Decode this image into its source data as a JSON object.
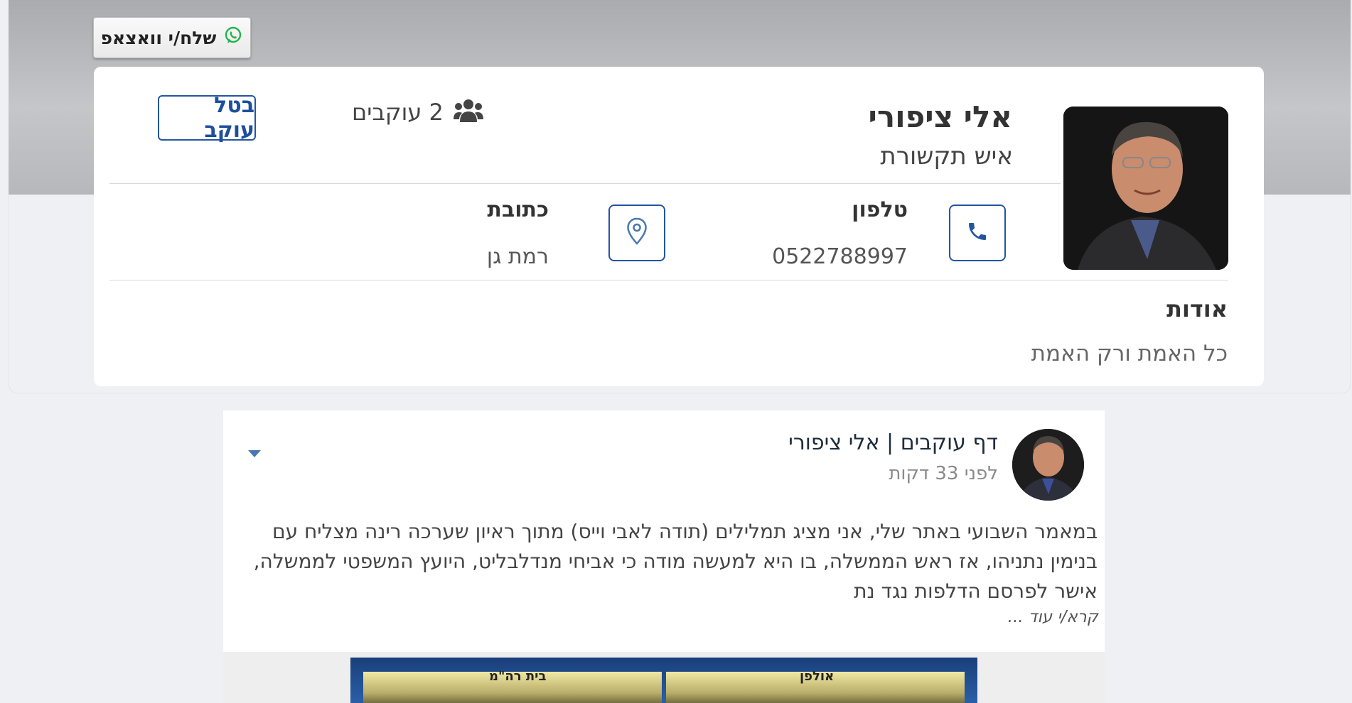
{
  "header": {
    "whatsapp_label": "שלח/י וואצאפ",
    "colors": {
      "whatsapp_icon": "#25b34a",
      "accent": "#2355a0"
    }
  },
  "profile": {
    "name": "אלי ציפורי",
    "title": "איש תקשורת",
    "followers_count": "2 עוקבים",
    "unfollow_label": "בטל עוקב",
    "phone": {
      "label": "טלפון",
      "value": "0522788997",
      "icon": "phone-icon"
    },
    "address": {
      "label": "כתובת",
      "value": "רמת גן",
      "icon": "map-pin-icon"
    },
    "about": {
      "heading": "אודות",
      "text": "כל האמת ורק האמת"
    }
  },
  "post": {
    "author": "דף עוקבים | אלי ציפורי",
    "time": "לפני 33 דקות",
    "text": "במאמר השבועי באתר שלי, אני מציג תמלילים (תודה לאבי וייס) מתוך ראיון שערכה רינה מצליח עם בנימין נתניהו, אז ראש הממשלה, בו היא למעשה מודה כי אביחי מנדלבליט, היועץ המשפטי לממשלה, אישר לפרסם הדלפות נגד נת",
    "read_more": "קרא/י עוד ...",
    "media": {
      "left_caption": "בית רה\"מ",
      "right_caption": "אולפן"
    }
  }
}
